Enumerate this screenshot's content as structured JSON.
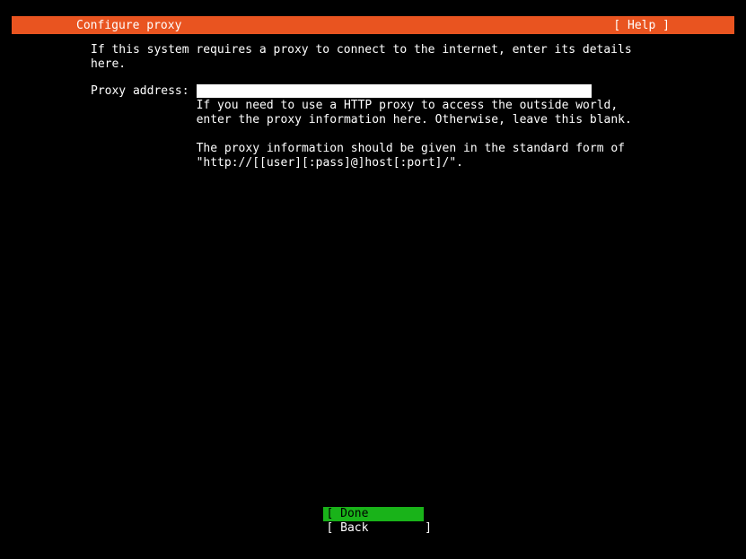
{
  "header": {
    "title": "Configure proxy",
    "help": "[ Help ]"
  },
  "intro": "If this system requires a proxy to connect to the internet, enter its details\nhere.",
  "form": {
    "label": "Proxy address:",
    "value": "",
    "help": "If you need to use a HTTP proxy to access the outside world,\nenter the proxy information here. Otherwise, leave this blank.\n\nThe proxy information should be given in the standard form of\n\"http://[[user][:pass]@]host[:port]/\"."
  },
  "footer": {
    "done": "[ Done        ]",
    "back": "[ Back        ]"
  }
}
